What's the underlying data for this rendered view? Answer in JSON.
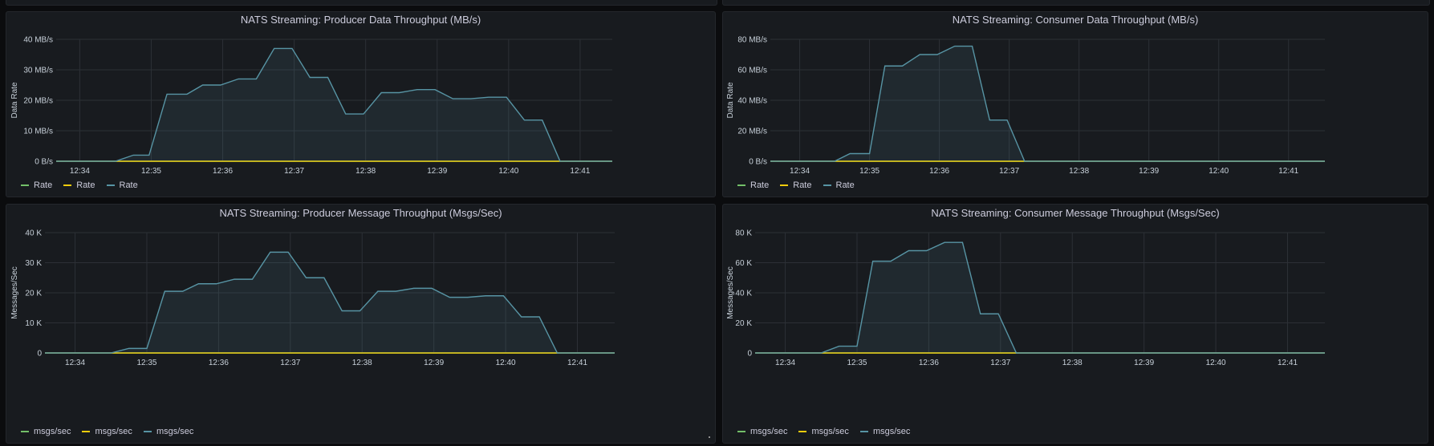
{
  "colors": {
    "background": "#0b0c0e",
    "panel": "#181b1f",
    "grid": "#2c3036",
    "series_green": "#73bf69",
    "series_yellow": "#f2cc0c",
    "series_teal": "#5794a4"
  },
  "panels": [
    {
      "title": "NATS Streaming: Producer Data Throughput (MB/s)",
      "ylabel": "Data Rate",
      "legend": [
        "Rate",
        "Rate",
        "Rate"
      ]
    },
    {
      "title": "NATS Streaming: Consumer Data Throughput (MB/s)",
      "ylabel": "Data Rate",
      "legend": [
        "Rate",
        "Rate",
        "Rate"
      ]
    },
    {
      "title": "NATS Streaming: Producer Message Throughput (Msgs/Sec)",
      "ylabel": "Messages/Sec",
      "legend": [
        "msgs/sec",
        "msgs/sec",
        "msgs/sec"
      ]
    },
    {
      "title": "NATS Streaming: Consumer Message Throughput (Msgs/Sec)",
      "ylabel": "Messages/Sec",
      "legend": [
        "msgs/sec",
        "msgs/sec",
        "msgs/sec"
      ]
    }
  ],
  "chart_data": [
    {
      "type": "area",
      "title": "NATS Streaming: Producer Data Throughput (MB/s)",
      "ylabel": "Data Rate",
      "x_ticks": [
        "12:34",
        "12:35",
        "12:36",
        "12:37",
        "12:38",
        "12:39",
        "12:40",
        "12:41"
      ],
      "y_ticks": [
        "0 B/s",
        "10 MB/s",
        "20 MB/s",
        "30 MB/s",
        "40 MB/s"
      ],
      "xlim": [
        -0.33,
        7.45
      ],
      "ylim": [
        0,
        40
      ],
      "series": [
        {
          "name": "Rate",
          "color": "#73bf69",
          "x": [
            -0.33,
            7.45
          ],
          "y": [
            0,
            0
          ]
        },
        {
          "name": "Rate",
          "color": "#f2cc0c",
          "x": [
            -0.33,
            7.45
          ],
          "y": [
            0,
            0
          ]
        },
        {
          "name": "Rate",
          "color": "#5794a4",
          "x": [
            -0.33,
            0.5,
            0.75,
            0.97,
            1.22,
            1.5,
            1.72,
            1.97,
            2.22,
            2.47,
            2.72,
            2.97,
            3.22,
            3.47,
            3.72,
            3.97,
            4.22,
            4.47,
            4.72,
            4.97,
            5.22,
            5.47,
            5.72,
            5.97,
            6.22,
            6.47,
            6.72,
            7.45
          ],
          "y": [
            0,
            0,
            2,
            2,
            22,
            22,
            25,
            25,
            27,
            27,
            37,
            37,
            27.5,
            27.5,
            15.5,
            15.5,
            22.5,
            22.5,
            23.5,
            23.5,
            20.5,
            20.5,
            21,
            21,
            13.5,
            13.5,
            0,
            0
          ]
        }
      ]
    },
    {
      "type": "area",
      "title": "NATS Streaming: Consumer Data Throughput (MB/s)",
      "ylabel": "Data Rate",
      "x_ticks": [
        "12:34",
        "12:35",
        "12:36",
        "12:37",
        "12:38",
        "12:39",
        "12:40",
        "12:41"
      ],
      "y_ticks": [
        "0 B/s",
        "20 MB/s",
        "40 MB/s",
        "60 MB/s",
        "80 MB/s"
      ],
      "xlim": [
        -0.42,
        7.52
      ],
      "ylim": [
        0,
        80
      ],
      "series": [
        {
          "name": "Rate",
          "color": "#73bf69",
          "x": [
            -0.42,
            7.52
          ],
          "y": [
            0,
            0
          ]
        },
        {
          "name": "Rate",
          "color": "#f2cc0c",
          "x": [
            -0.42,
            7.52
          ],
          "y": [
            0,
            0
          ]
        },
        {
          "name": "Rate",
          "color": "#5794a4",
          "x": [
            -0.42,
            0.5,
            0.72,
            1.0,
            1.22,
            1.47,
            1.72,
            1.97,
            2.22,
            2.47,
            2.72,
            2.97,
            3.22,
            7.52
          ],
          "y": [
            0,
            0,
            5,
            5,
            62.5,
            62.5,
            70,
            70,
            75.5,
            75.5,
            27,
            27,
            0,
            0
          ]
        }
      ]
    },
    {
      "type": "area",
      "title": "NATS Streaming: Producer Message Throughput (Msgs/Sec)",
      "ylabel": "Messages/Sec",
      "x_ticks": [
        "12:34",
        "12:35",
        "12:36",
        "12:37",
        "12:38",
        "12:39",
        "12:40",
        "12:41"
      ],
      "y_ticks": [
        "0",
        "10 K",
        "20 K",
        "30 K",
        "40 K"
      ],
      "xlim": [
        -0.42,
        7.52
      ],
      "ylim": [
        0,
        40
      ],
      "series": [
        {
          "name": "msgs/sec",
          "color": "#73bf69",
          "x": [
            -0.42,
            7.52
          ],
          "y": [
            0,
            0
          ]
        },
        {
          "name": "msgs/sec",
          "color": "#f2cc0c",
          "x": [
            -0.42,
            7.52
          ],
          "y": [
            0,
            0
          ]
        },
        {
          "name": "msgs/sec",
          "color": "#5794a4",
          "x": [
            -0.42,
            0.5,
            0.75,
            1.0,
            1.25,
            1.5,
            1.72,
            1.97,
            2.22,
            2.47,
            2.72,
            2.97,
            3.22,
            3.47,
            3.72,
            3.97,
            4.22,
            4.47,
            4.72,
            4.97,
            5.22,
            5.47,
            5.72,
            5.97,
            6.22,
            6.47,
            6.72,
            7.52
          ],
          "y": [
            0,
            0,
            1.5,
            1.5,
            20.5,
            20.5,
            23,
            23,
            24.5,
            24.5,
            33.5,
            33.5,
            25,
            25,
            14,
            14,
            20.5,
            20.5,
            21.5,
            21.5,
            18.5,
            18.5,
            19,
            19,
            12,
            12,
            0,
            0
          ]
        }
      ]
    },
    {
      "type": "area",
      "title": "NATS Streaming: Consumer Message Throughput (Msgs/Sec)",
      "ylabel": "Messages/Sec",
      "x_ticks": [
        "12:34",
        "12:35",
        "12:36",
        "12:37",
        "12:38",
        "12:39",
        "12:40",
        "12:41"
      ],
      "y_ticks": [
        "0",
        "20 K",
        "40 K",
        "60 K",
        "80 K"
      ],
      "xlim": [
        -0.42,
        7.52
      ],
      "ylim": [
        0,
        80
      ],
      "series": [
        {
          "name": "msgs/sec",
          "color": "#73bf69",
          "x": [
            -0.42,
            7.52
          ],
          "y": [
            0,
            0
          ]
        },
        {
          "name": "msgs/sec",
          "color": "#f2cc0c",
          "x": [
            -0.42,
            7.52
          ],
          "y": [
            0,
            0
          ]
        },
        {
          "name": "msgs/sec",
          "color": "#5794a4",
          "x": [
            -0.42,
            0.5,
            0.75,
            1.0,
            1.22,
            1.47,
            1.72,
            1.97,
            2.22,
            2.47,
            2.72,
            2.97,
            3.22,
            7.52
          ],
          "y": [
            0,
            0,
            4.5,
            4.5,
            61,
            61,
            68,
            68,
            73.5,
            73.5,
            26,
            26,
            0,
            0
          ]
        }
      ]
    }
  ]
}
